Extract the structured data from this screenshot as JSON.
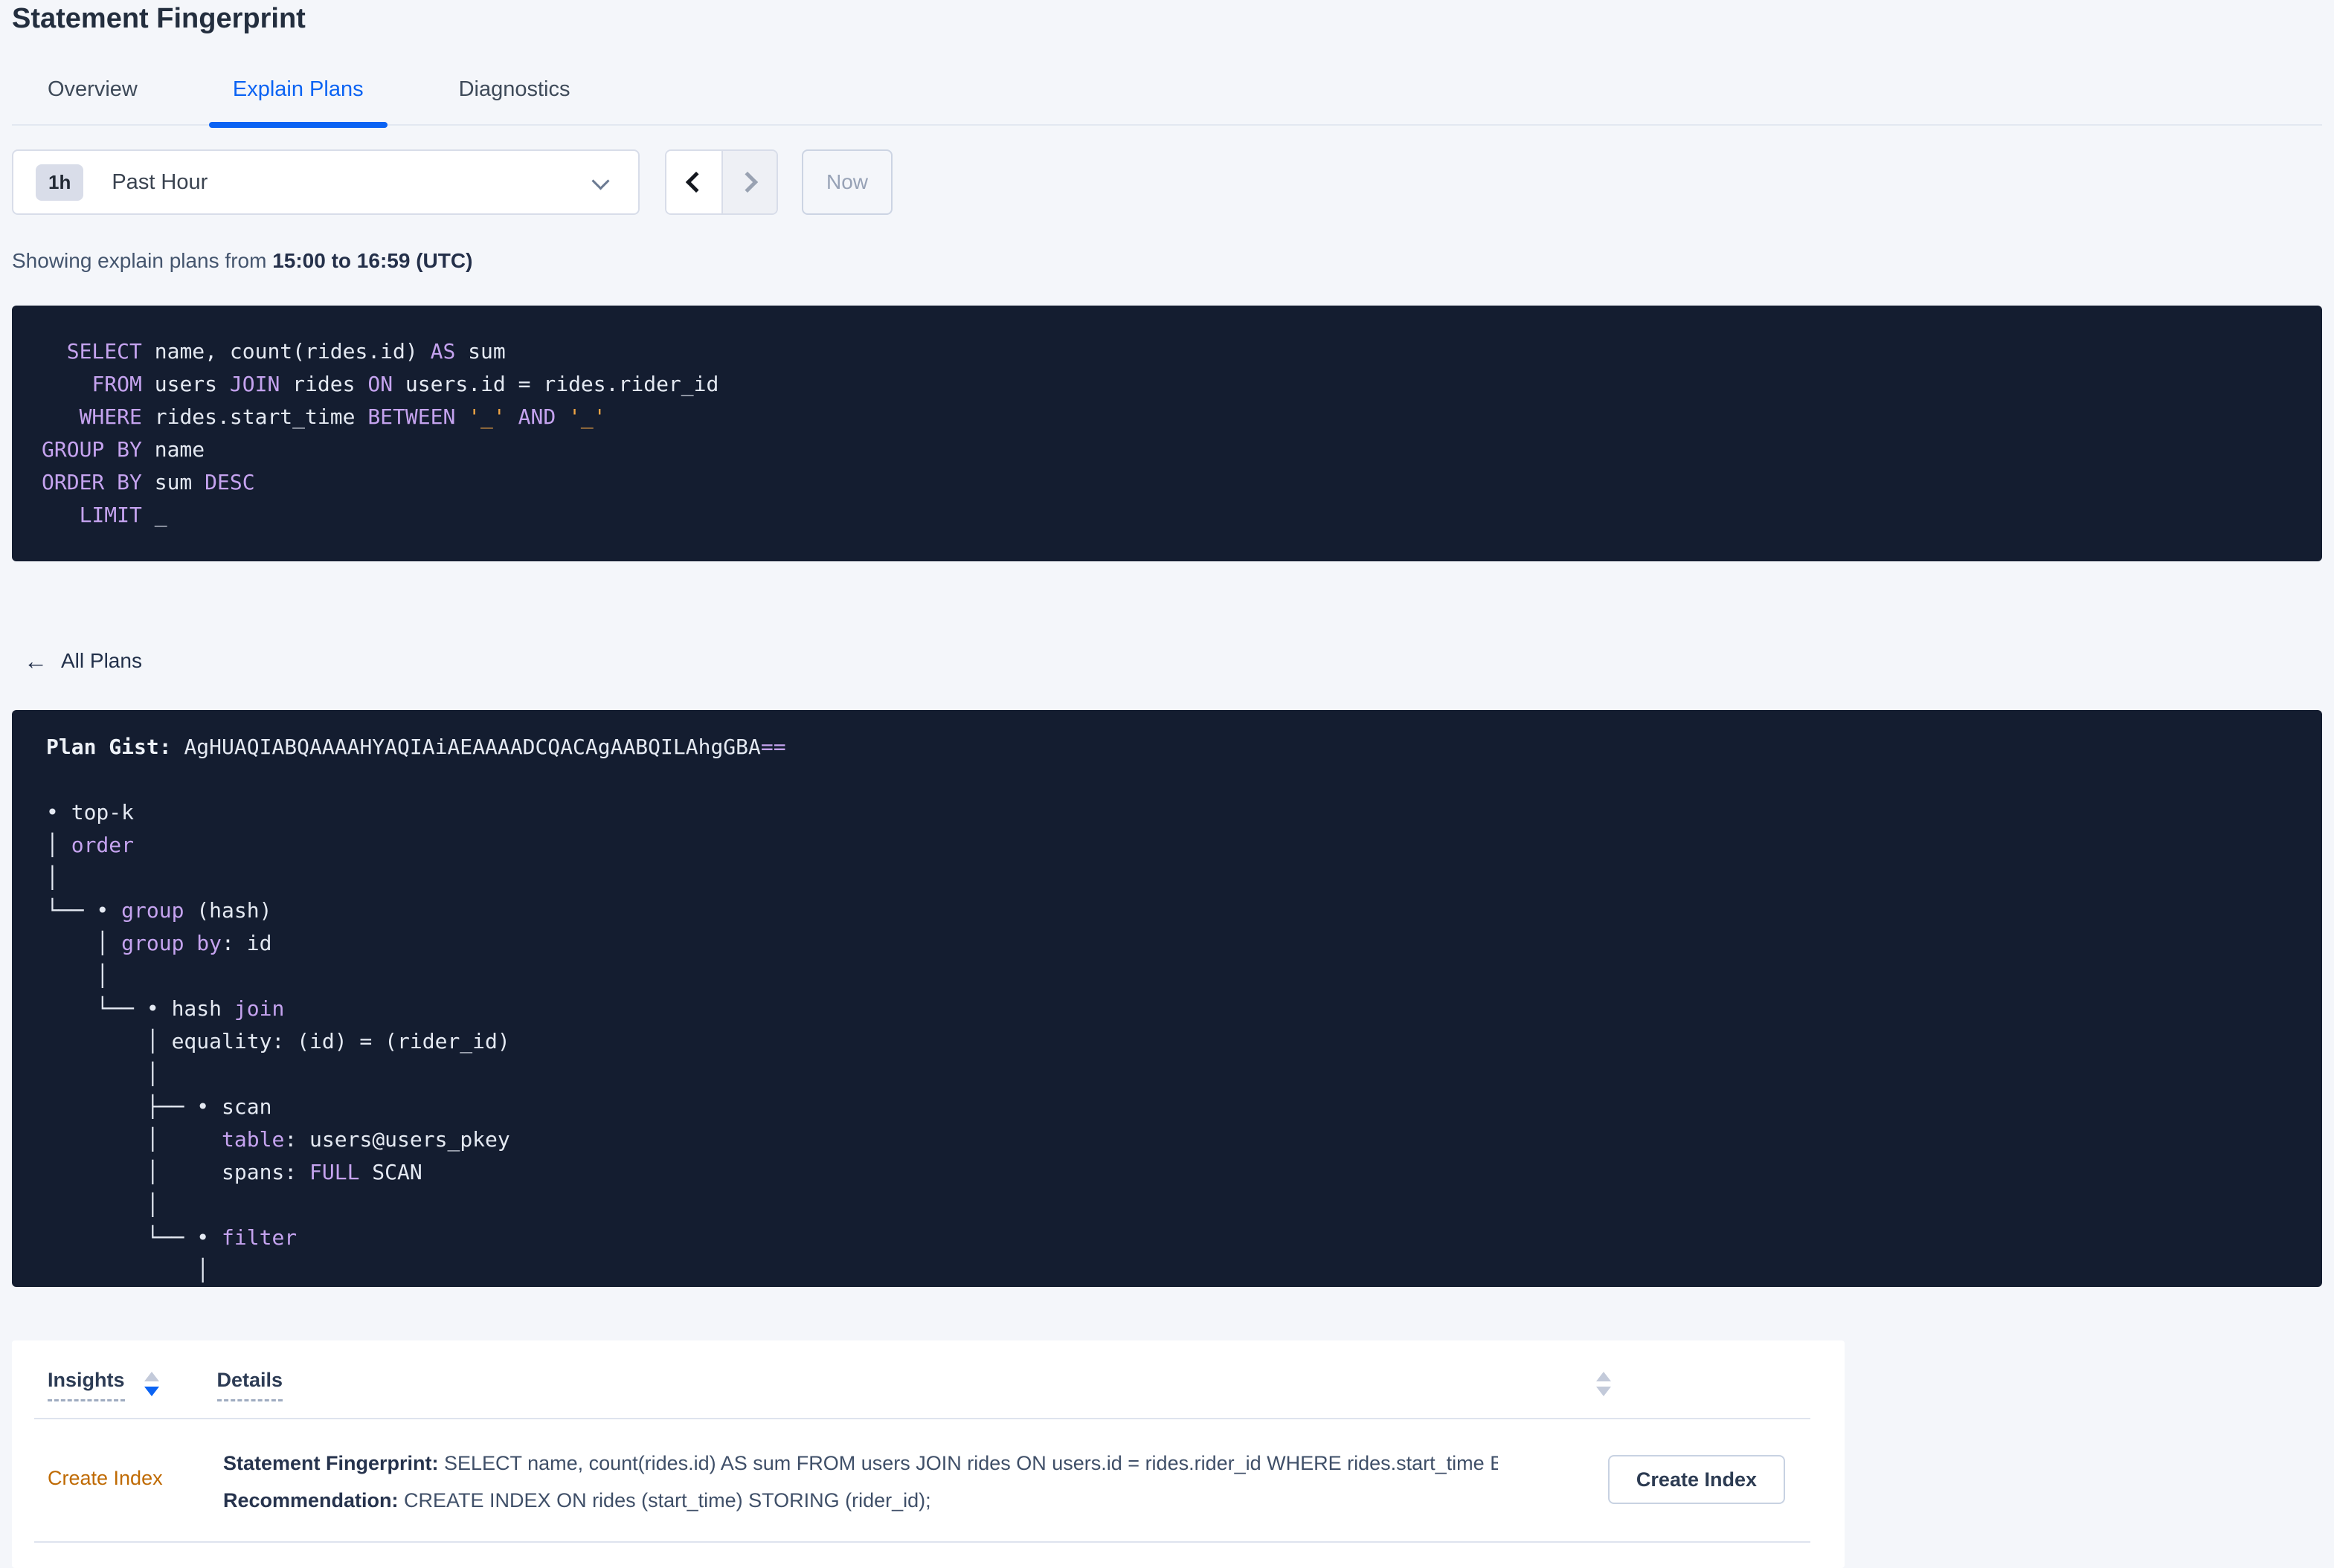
{
  "page": {
    "title": "Statement Fingerprint"
  },
  "tabs": [
    {
      "label": "Overview",
      "active": false
    },
    {
      "label": "Explain Plans",
      "active": true
    },
    {
      "label": "Diagnostics",
      "active": false
    }
  ],
  "time_controls": {
    "interval_badge": "1h",
    "interval_label": "Past Hour",
    "now_label": "Now"
  },
  "caption": {
    "prefix": "Showing explain plans from ",
    "range_bold": "15:00 to 16:59 (UTC)"
  },
  "sql_statement": {
    "lines": [
      [
        {
          "t": "  ",
          "c": "p"
        },
        {
          "t": "SELECT",
          "c": "k"
        },
        {
          "t": " name, count(rides.id) ",
          "c": "p"
        },
        {
          "t": "AS",
          "c": "k"
        },
        {
          "t": " sum",
          "c": "p"
        }
      ],
      [
        {
          "t": "    ",
          "c": "p"
        },
        {
          "t": "FROM",
          "c": "k"
        },
        {
          "t": " users ",
          "c": "p"
        },
        {
          "t": "JOIN",
          "c": "k"
        },
        {
          "t": " rides ",
          "c": "p"
        },
        {
          "t": "ON",
          "c": "k"
        },
        {
          "t": " users.id = rides.rider_id",
          "c": "p"
        }
      ],
      [
        {
          "t": "   ",
          "c": "p"
        },
        {
          "t": "WHERE",
          "c": "k"
        },
        {
          "t": " rides.start_time ",
          "c": "p"
        },
        {
          "t": "BETWEEN",
          "c": "k"
        },
        {
          "t": " ",
          "c": "p"
        },
        {
          "t": "'_'",
          "c": "o"
        },
        {
          "t": " ",
          "c": "p"
        },
        {
          "t": "AND",
          "c": "k"
        },
        {
          "t": " ",
          "c": "p"
        },
        {
          "t": "'_'",
          "c": "o"
        }
      ],
      [
        {
          "t": "GROUP BY",
          "c": "k"
        },
        {
          "t": " name",
          "c": "p"
        }
      ],
      [
        {
          "t": "ORDER BY",
          "c": "k"
        },
        {
          "t": " sum ",
          "c": "p"
        },
        {
          "t": "DESC",
          "c": "k"
        }
      ],
      [
        {
          "t": "   ",
          "c": "p"
        },
        {
          "t": "LIMIT",
          "c": "k"
        },
        {
          "t": " _",
          "c": "p"
        }
      ]
    ]
  },
  "all_plans": {
    "label": "All Plans"
  },
  "plan_gist": {
    "lines": [
      [
        {
          "t": "Plan Gist: ",
          "c": "b"
        },
        {
          "t": "AgHUAQIABQAAAAHYAQIAiAEAAAADCQACAgAABQILAhgGBA",
          "c": "p"
        },
        {
          "t": "==",
          "c": "k"
        }
      ],
      [
        {
          "t": "",
          "c": "p"
        }
      ],
      [
        {
          "t": "• top-k",
          "c": "p"
        }
      ],
      [
        {
          "t": "│ ",
          "c": "p"
        },
        {
          "t": "order",
          "c": "k"
        }
      ],
      [
        {
          "t": "│",
          "c": "p"
        }
      ],
      [
        {
          "t": "└── • ",
          "c": "p"
        },
        {
          "t": "group",
          "c": "k"
        },
        {
          "t": " (hash)",
          "c": "p"
        }
      ],
      [
        {
          "t": "    │ ",
          "c": "p"
        },
        {
          "t": "group by",
          "c": "k"
        },
        {
          "t": ": id",
          "c": "p"
        }
      ],
      [
        {
          "t": "    │",
          "c": "p"
        }
      ],
      [
        {
          "t": "    └── • hash ",
          "c": "p"
        },
        {
          "t": "join",
          "c": "k"
        }
      ],
      [
        {
          "t": "        │ equality: (id) = (rider_id)",
          "c": "p"
        }
      ],
      [
        {
          "t": "        │",
          "c": "p"
        }
      ],
      [
        {
          "t": "        ├── • scan",
          "c": "p"
        }
      ],
      [
        {
          "t": "        │     ",
          "c": "p"
        },
        {
          "t": "table",
          "c": "k"
        },
        {
          "t": ": users@users_pkey",
          "c": "p"
        }
      ],
      [
        {
          "t": "        │     spans: ",
          "c": "p"
        },
        {
          "t": "FULL",
          "c": "k"
        },
        {
          "t": " SCAN",
          "c": "p"
        }
      ],
      [
        {
          "t": "        │",
          "c": "p"
        }
      ],
      [
        {
          "t": "        └── • ",
          "c": "p"
        },
        {
          "t": "filter",
          "c": "k"
        }
      ],
      [
        {
          "t": "            │",
          "c": "p"
        }
      ]
    ]
  },
  "insights_table": {
    "columns": [
      {
        "label": "Insights",
        "sort": "desc"
      },
      {
        "label": "Details",
        "sort": "none"
      }
    ],
    "rows": [
      {
        "insight": "Create Index",
        "details": [
          {
            "label": "Statement Fingerprint:",
            "text": " SELECT name, count(rides.id) AS sum FROM users JOIN rides ON users.id = rides.rider_id WHERE rides.start_time BETWEEN '_..."
          },
          {
            "label": "Recommendation:",
            "text": " CREATE INDEX ON rides (start_time) STORING (rider_id);"
          }
        ],
        "action_label": "Create Index"
      }
    ]
  },
  "colors": {
    "accent_blue": "#0b63f3",
    "code_background": "#141d30",
    "code_keyword": "#c5a3ef",
    "code_literal": "#efa444",
    "insight_orange": "#bf6a02"
  }
}
